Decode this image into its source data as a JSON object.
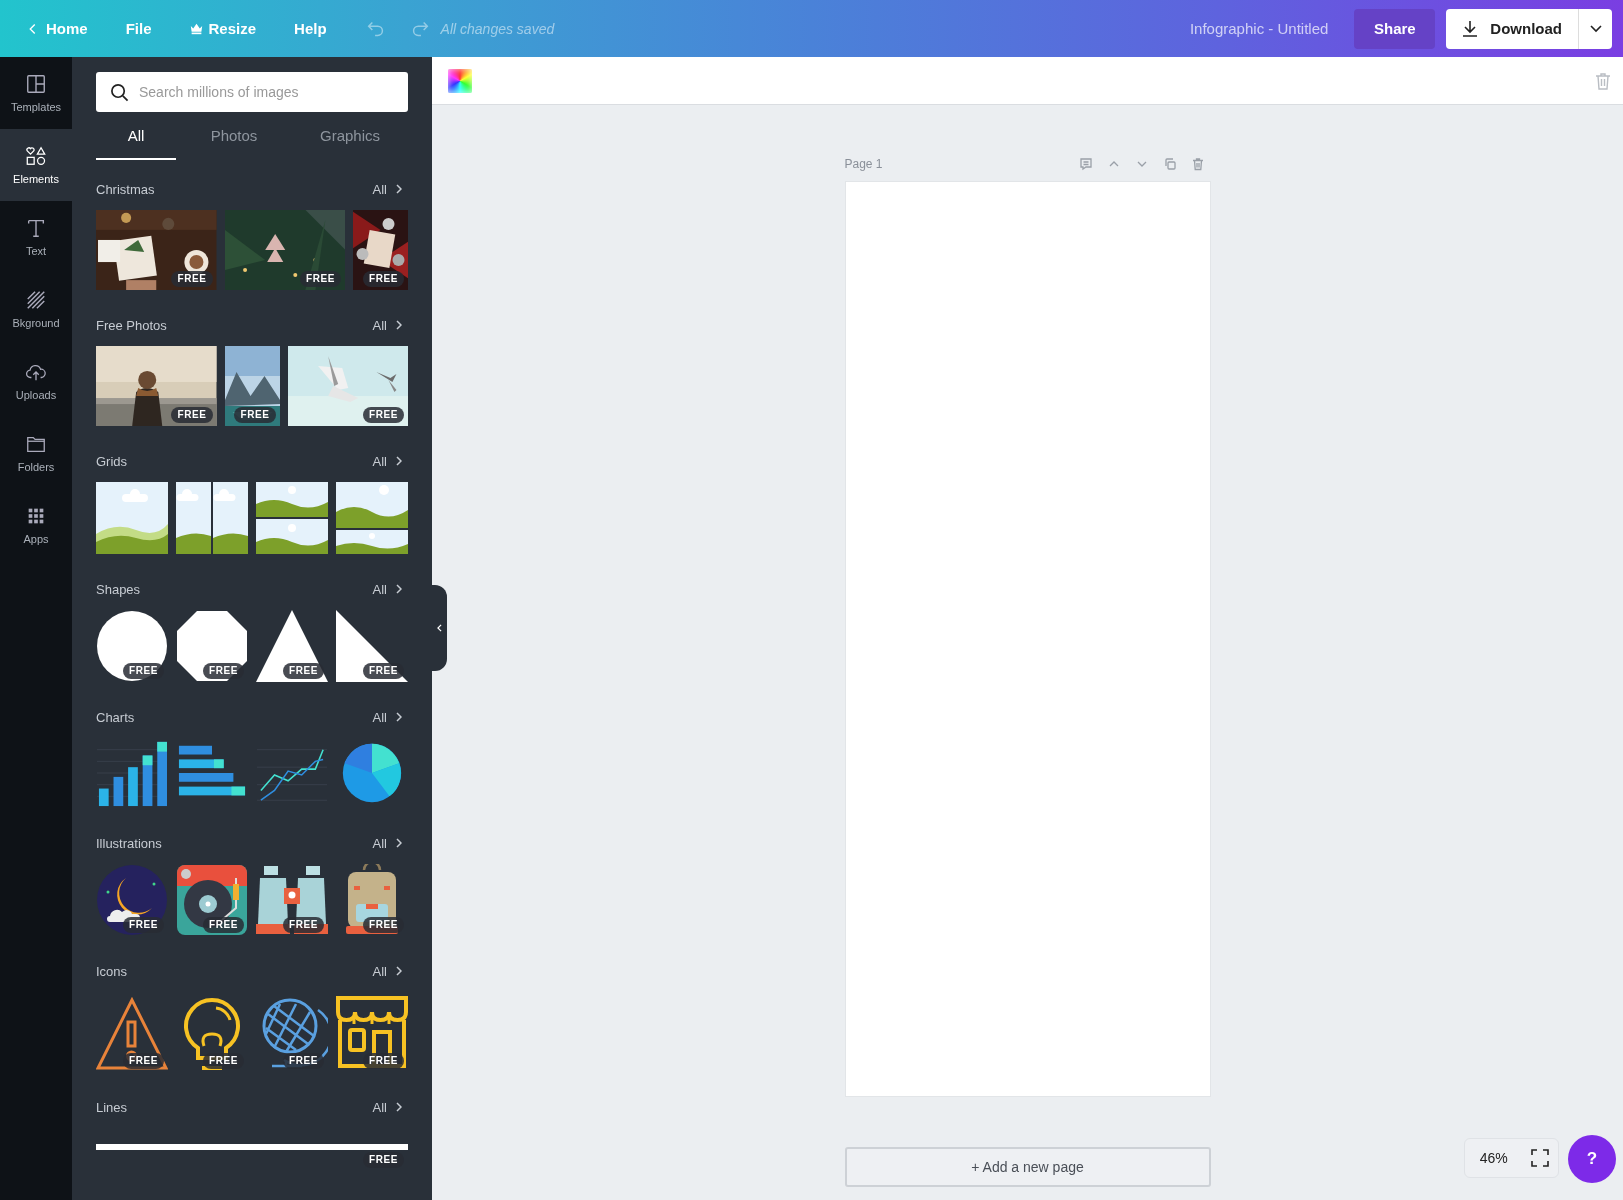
{
  "topbar": {
    "nav": [
      {
        "label": "Home",
        "kind": "back"
      },
      {
        "label": "File",
        "kind": "plain"
      },
      {
        "label": "Resize",
        "kind": "crown"
      },
      {
        "label": "Help",
        "kind": "plain"
      }
    ],
    "status": "All changes saved",
    "title": "Infographic - Untitled",
    "share": "Share",
    "download": "Download"
  },
  "rail": [
    {
      "label": "Templates",
      "kind": "templates",
      "selected": false
    },
    {
      "label": "Elements",
      "kind": "elements",
      "selected": true
    },
    {
      "label": "Text",
      "kind": "text",
      "selected": false
    },
    {
      "label": "Bkground",
      "kind": "background",
      "selected": false
    },
    {
      "label": "Uploads",
      "kind": "uploads",
      "selected": false
    },
    {
      "label": "Folders",
      "kind": "folders",
      "selected": false
    },
    {
      "label": "Apps",
      "kind": "apps",
      "selected": false
    }
  ],
  "panel": {
    "search": {
      "placeholder": "Search millions of images"
    },
    "tabs": [
      {
        "label": "All",
        "selected": true
      },
      {
        "label": "Photos",
        "selected": false
      },
      {
        "label": "Graphics",
        "selected": false
      }
    ],
    "sections": [
      {
        "title": "Christmas",
        "link": "All",
        "kind": "photos",
        "items": [
          {
            "kind": "picture",
            "badge": "FREE"
          },
          {
            "kind": "picture",
            "badge": "FREE"
          },
          {
            "kind": "tall-picture",
            "badge": "FREE"
          }
        ]
      },
      {
        "title": "Free Photos",
        "link": "All",
        "kind": "photos",
        "items": [
          {
            "kind": "picture",
            "badge": "FREE"
          },
          {
            "kind": "tall-picture",
            "badge": "FREE"
          },
          {
            "kind": "picture",
            "badge": "FREE"
          }
        ]
      },
      {
        "title": "Grids",
        "link": "All",
        "kind": "grids",
        "items": [
          {
            "kind": "grid-single"
          },
          {
            "kind": "grid-split"
          },
          {
            "kind": "grid-rows"
          },
          {
            "kind": "grid-stack"
          }
        ]
      },
      {
        "title": "Shapes",
        "link": "All",
        "kind": "shapes",
        "items": [
          {
            "kind": "circle",
            "badge": "FREE"
          },
          {
            "kind": "octagon",
            "badge": "FREE"
          },
          {
            "kind": "triangle",
            "badge": "FREE"
          },
          {
            "kind": "right-triangle",
            "badge": "FREE"
          }
        ]
      },
      {
        "title": "Charts",
        "link": "All",
        "kind": "charts",
        "items": [
          {
            "kind": "bar-chart"
          },
          {
            "kind": "hbar-chart"
          },
          {
            "kind": "line-chart"
          },
          {
            "kind": "pie-chart"
          }
        ]
      },
      {
        "title": "Illustrations",
        "link": "All",
        "kind": "illustrations",
        "items": [
          {
            "kind": "moon",
            "badge": "FREE"
          },
          {
            "kind": "turntable",
            "badge": "FREE"
          },
          {
            "kind": "binoculars",
            "badge": "FREE"
          },
          {
            "kind": "backpack",
            "badge": "FREE"
          }
        ]
      },
      {
        "title": "Icons",
        "link": "All",
        "kind": "icons",
        "items": [
          {
            "kind": "warning",
            "badge": "FREE"
          },
          {
            "kind": "bulb",
            "badge": "FREE"
          },
          {
            "kind": "globe",
            "badge": "FREE"
          },
          {
            "kind": "shop",
            "badge": "FREE"
          }
        ]
      },
      {
        "title": "Lines",
        "link": "All",
        "kind": "lines",
        "items": [
          {
            "kind": "line",
            "badge": "FREE"
          }
        ]
      }
    ]
  },
  "canvas": {
    "page_label": "Page 1",
    "add_page": "+ Add a new page",
    "zoom": "46%",
    "help": "?"
  }
}
